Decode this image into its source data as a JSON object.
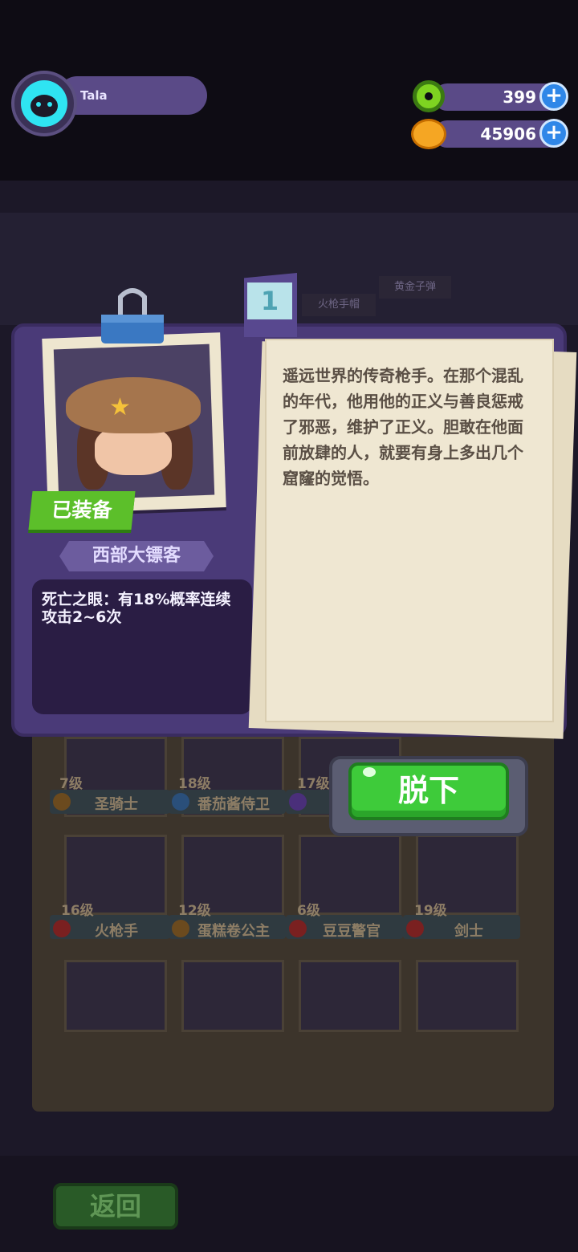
{
  "player": {
    "name": "Tala"
  },
  "currencies": [
    {
      "icon": "donut-icon",
      "value": "399"
    },
    {
      "icon": "coin-icon",
      "value": "45906"
    }
  ],
  "shelf_labels": [
    "火枪手帽",
    "黄金子弹"
  ],
  "modal": {
    "page_number": "1",
    "equipped_badge": "已装备",
    "character_name": "西部大镖客",
    "skill": "死亡之眼：有18%概率连续攻击2~6次",
    "description": "遥远世界的传奇枪手。在那个混乱的年代，他用他的正义与善良惩戒了邪恶，维护了正义。胆敢在他面前放肆的人，就要有身上多出几个窟窿的觉悟。",
    "unequip_label": "脱下"
  },
  "roster": [
    {
      "level": "7级",
      "name": "圣骑士"
    },
    {
      "level": "18级",
      "name": "番茄酱侍卫"
    },
    {
      "level": "17级",
      "name": ""
    },
    {
      "level": "16级",
      "name": "火枪手"
    },
    {
      "level": "12级",
      "name": "蛋糕卷公主"
    },
    {
      "level": "6级",
      "name": "豆豆警官"
    },
    {
      "level": "19级",
      "name": "剑士"
    }
  ],
  "back_label": "返回",
  "colors": {
    "accent_green": "#3ecb3a",
    "modal_purple": "#4a3a78",
    "paper": "#efe7d2"
  }
}
